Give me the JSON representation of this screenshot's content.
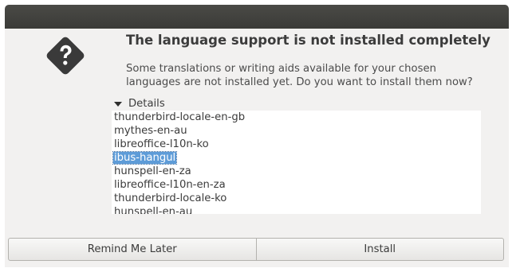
{
  "dialog": {
    "heading": "The language support is not installed completely",
    "message": "Some translations or writing aids available for your chosen languages are not installed yet. Do you want to install them now?",
    "icon": "question-icon",
    "details_label": "Details"
  },
  "packages": [
    {
      "name": "thunderbird-locale-en-gb",
      "selected": false
    },
    {
      "name": "mythes-en-au",
      "selected": false
    },
    {
      "name": "libreoffice-l10n-ko",
      "selected": false
    },
    {
      "name": "ibus-hangul",
      "selected": true
    },
    {
      "name": "hunspell-en-za",
      "selected": false
    },
    {
      "name": "libreoffice-l10n-en-za",
      "selected": false
    },
    {
      "name": "thunderbird-locale-ko",
      "selected": false
    },
    {
      "name": "hunspell-en-au",
      "selected": false
    }
  ],
  "buttons": {
    "remind_label": "Remind Me Later",
    "install_label": "Install"
  },
  "colors": {
    "titlebar": "#3f3f3c",
    "dialog_bg": "#f2f1f0",
    "selection": "#5e9cd8",
    "icon": "#3a3a3a"
  }
}
